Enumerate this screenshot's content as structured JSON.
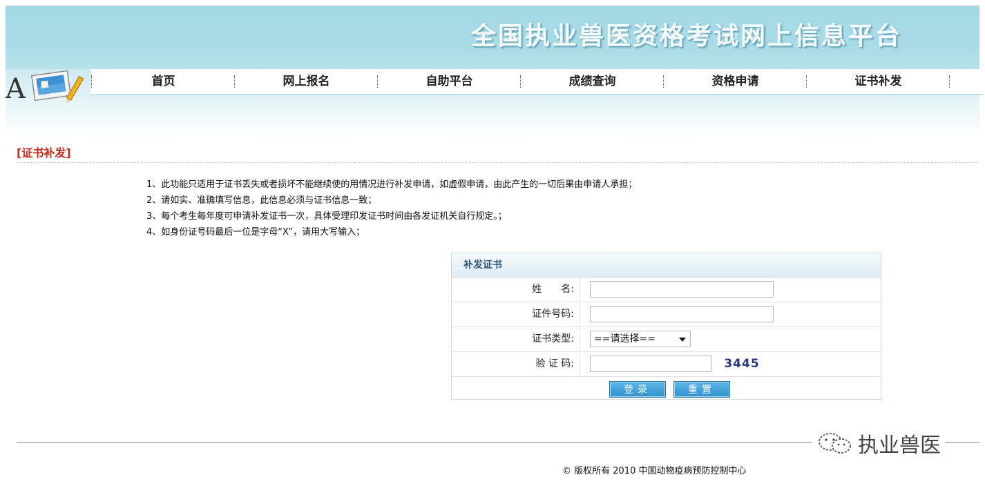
{
  "header": {
    "site_title": "全国执业兽医资格考试网上信息平台"
  },
  "logo": {
    "letter": "A"
  },
  "nav": {
    "items": [
      {
        "label": "首页"
      },
      {
        "label": "网上报名"
      },
      {
        "label": "自助平台"
      },
      {
        "label": "成绩查询"
      },
      {
        "label": "资格申请"
      },
      {
        "label": "证书补发"
      }
    ]
  },
  "section": {
    "heading": "[证书补发]"
  },
  "notices": [
    "1、此功能只适用于证书丢失或者损坏不能继续使的用情况进行补发申请，如虚假申请，由此产生的一切后果由申请人承担；",
    "2、请如实、准确填写信息，此信息必须与证书信息一致；",
    "3、每个考生每年度可申请补发证书一次，具体受理印发证书时间由各发证机关自行规定。；",
    "4、如身份证号码最后一位是字母“X”，请用大写输入；"
  ],
  "form": {
    "title": "补发证书",
    "name_label": "姓　　名:",
    "name_value": "",
    "id_label": "证件号码:",
    "id_value": "",
    "type_label": "证书类型:",
    "type_selected": "==请选择==",
    "captcha_label": "验 证 码:",
    "captcha_value": "",
    "captcha_code": "3445",
    "login_button": "登录",
    "reset_button": "重置"
  },
  "watermark": {
    "text": "执业兽医",
    "icon": "wechat-icon"
  },
  "footer": {
    "copyright": "© 版权所有  2010 中国动物疫病预防控制中心"
  }
}
